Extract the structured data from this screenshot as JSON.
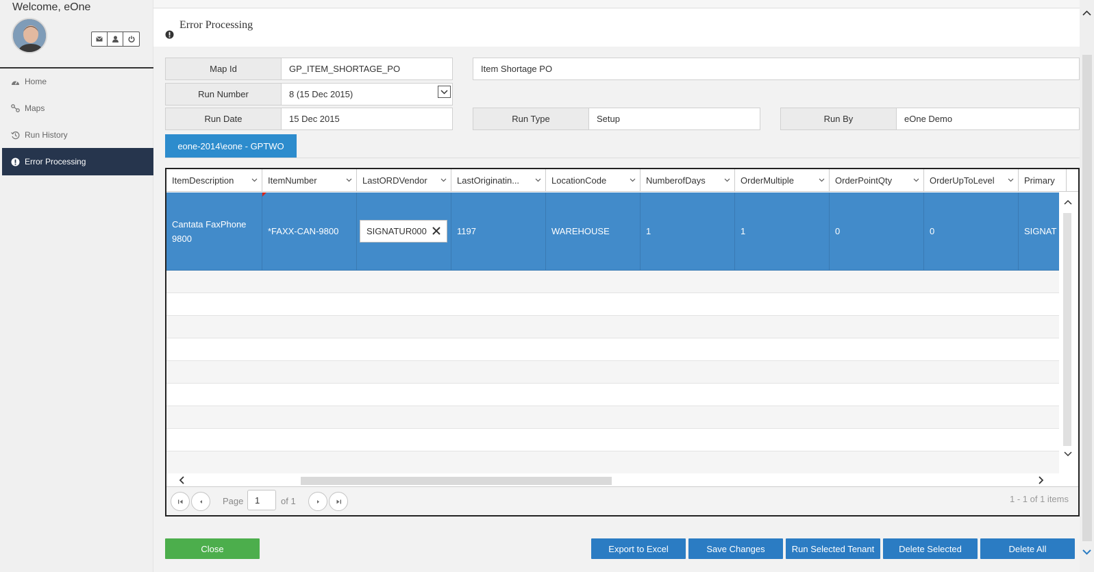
{
  "sidebar": {
    "welcome": "Welcome, eOne",
    "user_buttons": [
      "envelope-icon",
      "user-icon",
      "power-icon"
    ],
    "items": [
      {
        "label": "Home",
        "icon": "dashboard-icon",
        "active": false
      },
      {
        "label": "Maps",
        "icon": "route-icon",
        "active": false
      },
      {
        "label": "Run History",
        "icon": "history-icon",
        "active": false
      },
      {
        "label": "Error Processing",
        "icon": "exclamation-circle-icon",
        "active": true
      }
    ]
  },
  "header": {
    "title": "Error Processing",
    "icon": "exclamation-circle-icon"
  },
  "form": {
    "map_id_label": "Map Id",
    "map_id_value": "GP_ITEM_SHORTAGE_PO",
    "map_name": "Item Shortage PO",
    "run_number_label": "Run Number",
    "run_number_value": "8 (15 Dec 2015)",
    "run_date_label": "Run Date",
    "run_date_value": "15 Dec 2015",
    "run_type_label": "Run Type",
    "run_type_value": "Setup",
    "run_by_label": "Run By",
    "run_by_value": "eOne Demo"
  },
  "tenant_tab": "eone-2014\\eone - GPTWO",
  "grid": {
    "columns": [
      "ItemDescription",
      "ItemNumber",
      "LastORDVendor",
      "LastOriginatin...",
      "LocationCode",
      "NumberofDays",
      "OrderMultiple",
      "OrderPointQty",
      "OrderUpToLevel",
      "Primary"
    ],
    "rows": [
      {
        "cells": [
          "Cantata FaxPhone 9800",
          "*FAXX-CAN-9800",
          "SIGNATUR000",
          "1197",
          "WAREHOUSE",
          "1",
          "1",
          "0",
          "0",
          "SIGNAT"
        ]
      }
    ],
    "pager": {
      "page_label": "Page",
      "page_value": "1",
      "of_label": "of 1",
      "info": "1 - 1 of 1 items"
    }
  },
  "buttons": {
    "close": "Close",
    "export": "Export to Excel",
    "save": "Save Changes",
    "run_tenant": "Run Selected Tenant",
    "delete_selected": "Delete Selected",
    "delete_all": "Delete All"
  },
  "colors": {
    "sidebar_active": "#26354d",
    "selected_row": "#428bca",
    "primary_button": "#2b7cc3",
    "close_button": "#4cae4c",
    "tab": "#2d8ccd"
  }
}
